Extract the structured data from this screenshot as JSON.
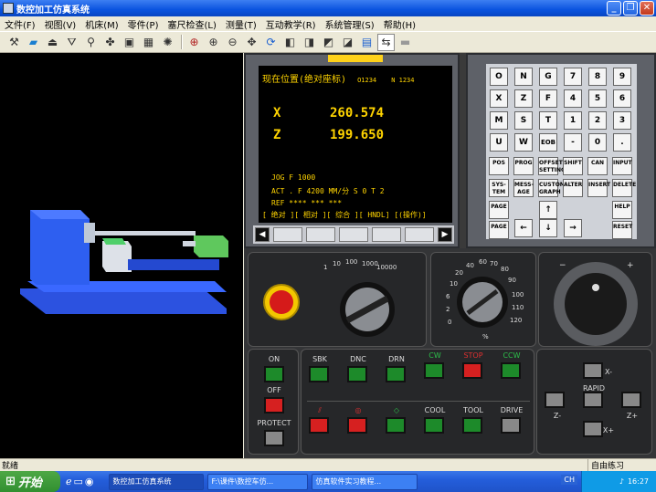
{
  "window": {
    "title": "数控加工仿真系统"
  },
  "menu": [
    "文件(F)",
    "视图(V)",
    "机床(M)",
    "零件(P)",
    "塞尺检查(L)",
    "测量(T)",
    "互动教学(R)",
    "系统管理(S)",
    "帮助(H)"
  ],
  "cnc_screen": {
    "header": "现在位置(绝对座标)",
    "program": "O1234",
    "block": "N  1234",
    "x_label": "X",
    "x_value": "260.574",
    "z_label": "Z",
    "z_value": "199.650",
    "line1": "JOG  F 1000",
    "line2": "ACT . F 4200  MM/分     S  0    T  2",
    "line3": "REF **** *** ***",
    "line4": "[ 绝对 ][ 相对 ][ 综合 ][ HNDL] [(操作)]"
  },
  "keypad": {
    "rows": [
      [
        "O",
        "N",
        "G",
        "7",
        "8",
        "9"
      ],
      [
        "X",
        "Z",
        "F",
        "4",
        "5",
        "6"
      ],
      [
        "M",
        "S",
        "T",
        "1",
        "2",
        "3"
      ],
      [
        "U",
        "W",
        "EOB",
        "-",
        "0",
        "."
      ]
    ],
    "func_row1": [
      "POS",
      "PROG",
      "OFFSET SETTING",
      "SHIFT",
      "CAN",
      "INPUT"
    ],
    "func_row2": [
      "SYS-TEM",
      "MESS-AGE",
      "CUSTOM GRAPH",
      "ALTER",
      "INSERT",
      "DELETE"
    ],
    "page_up": "PAGE",
    "page_down": "PAGE",
    "help": "HELP",
    "reset": "RESET"
  },
  "dial_feed": {
    "scale": [
      "1",
      "10",
      "100",
      "1000",
      "10000"
    ]
  },
  "dial_override": {
    "scale": [
      "0",
      "2",
      "6",
      "10",
      "20",
      "40",
      "60",
      "70",
      "80",
      "90",
      "100",
      "110",
      "120"
    ],
    "unit": "%"
  },
  "buttons": {
    "on": "ON",
    "off": "OFF",
    "protect": "PROTECT",
    "sbk": "SBK",
    "dnc": "DNC",
    "drn": "DRN",
    "cw": "CW",
    "stop": "STOP",
    "ccw": "CCW",
    "cool": "COOL",
    "tool": "TOOL",
    "drive": "DRIVE",
    "rapid": "RAPID",
    "x_minus": "X-",
    "x_plus": "X+",
    "z_minus": "Z-",
    "z_plus": "Z+"
  },
  "status": {
    "left": "就绪",
    "right": "自由练习"
  },
  "taskbar": {
    "start": "开始",
    "tasks": [
      "数控加工仿真系统",
      "F:\\课件\\数控车仿...",
      "仿真软件实习教程..."
    ],
    "lang": "CH",
    "time": "16:27"
  }
}
